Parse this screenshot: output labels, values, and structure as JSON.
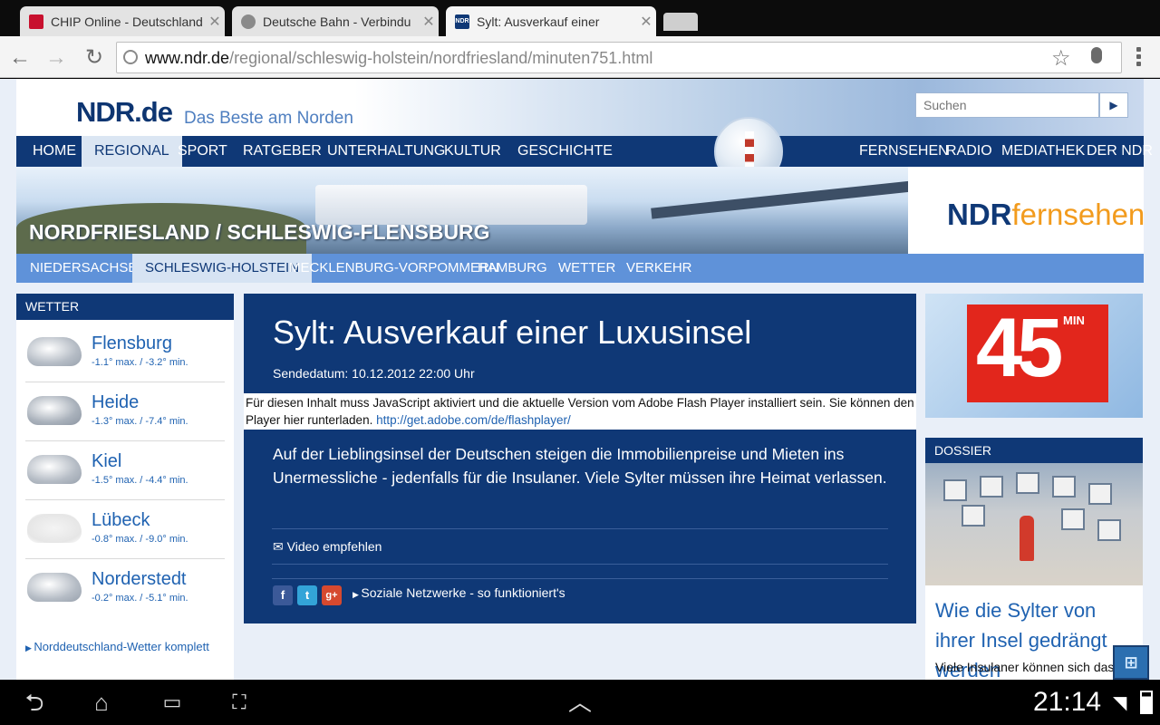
{
  "browser": {
    "tabs": [
      {
        "title": "CHIP Online - Deutschland",
        "favicon_color": "#c8102e"
      },
      {
        "title": "Deutsche Bahn - Verbindu",
        "favicon_color": "#8a8a8a"
      },
      {
        "title": "Sylt: Ausverkauf einer",
        "favicon_color": "#0f3876",
        "favicon_text": "NDR"
      }
    ],
    "url_host": "www.ndr.de",
    "url_path": "/regional/schleswig-holstein/nordfriesland/minuten751.html"
  },
  "site": {
    "logo": "NDR",
    "logo_suffix": ".de",
    "slogan": "Das Beste am Norden",
    "search_placeholder": "Suchen",
    "main_nav_left": [
      "HOME",
      "REGIONAL",
      "SPORT",
      "RATGEBER",
      "UNTERHALTUNG",
      "KULTUR",
      "GESCHICHTE"
    ],
    "main_nav_right": [
      "FERNSEHEN",
      "RADIO",
      "MEDIATHEK",
      "DER NDR"
    ],
    "banner_title": "NORDFRIESLAND / SCHLESWIG-FLENSBURG",
    "ndr_fernsehen_a": "NDR",
    "ndr_fernsehen_b": "fernsehen",
    "sub_nav": [
      "NIEDERSACHSEN",
      "SCHLESWIG-HOLSTEIN",
      "MECKLENBURG-VORPOMMERN",
      "HAMBURG",
      "WETTER",
      "VERKEHR"
    ]
  },
  "weather": {
    "heading": "WETTER",
    "cities": [
      {
        "name": "Flensburg",
        "temps": "-1.1° max. / -3.2° min."
      },
      {
        "name": "Heide",
        "temps": "-1.3° max. / -7.4° min."
      },
      {
        "name": "Kiel",
        "temps": "-1.5° max. / -4.4° min."
      },
      {
        "name": "Lübeck",
        "temps": "-0.8° max. / -9.0° min."
      },
      {
        "name": "Norderstedt",
        "temps": "-0.2° max. / -5.1° min."
      }
    ],
    "link": "Norddeutschland-Wetter komplett"
  },
  "article": {
    "title": "Sylt: Ausverkauf einer Luxusinsel",
    "date": "Sendedatum: 10.12.2012 22:00 Uhr",
    "flash_note": "Für diesen Inhalt muss JavaScript aktiviert und die aktuelle Version vom Adobe Flash Player installiert sein. Sie können den Player hier runterladen.",
    "flash_link": "http://get.adobe.com/de/flashplayer/",
    "lead": "Auf der Lieblingsinsel der Deutschen steigen die Immobilienpreise und Mieten ins Unermessliche - jedenfalls für die Insulaner. Viele Sylter müssen ihre Heimat verlassen.",
    "recommend": "Video empfehlen",
    "social": "Soziale Netzwerke - so funktioniert's"
  },
  "sidebar": {
    "promo_number": "45",
    "promo_min": "MIN",
    "dossier_heading": "DOSSIER",
    "dossier_title": "Wie die Sylter von ihrer Insel gedrängt werden",
    "dossier_text": "Viele Insulaner können sich das"
  },
  "system": {
    "clock": "21:14"
  },
  "colors": {
    "ndr_blue": "#0f3876",
    "link_blue": "#1f62b1",
    "subnav_blue": "#5f92d9",
    "accent_red": "#e2261c",
    "fernsehen_orange": "#f29b1d"
  }
}
